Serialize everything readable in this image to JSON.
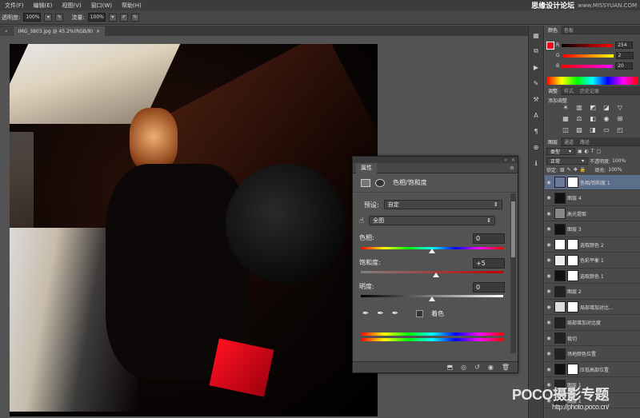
{
  "menubar": {
    "items": [
      "文件(F)",
      "编辑(E)",
      "视图(V)",
      "窗口(W)",
      "帮助(H)"
    ],
    "watermark": "思缘设计论坛",
    "watermark_url": "www.MISSYUAN.COM"
  },
  "optionsbar": {
    "opacity_label": "透明度:",
    "opacity_value": "100%",
    "flow_label": "流量:",
    "flow_value": "100%"
  },
  "tabs": [
    {
      "label": "IMG_3803.jpg @ 45.2%(RGB/8)",
      "close": "×"
    }
  ],
  "properties": {
    "panel_title": "属性",
    "adjustment_name": "色相/饱和度",
    "preset_label": "预设:",
    "preset_value": "自定",
    "channel_value": "全图",
    "hue_label": "色相:",
    "hue_value": "0",
    "saturation_label": "饱和度:",
    "saturation_value": "+5",
    "lightness_label": "明度:",
    "lightness_value": "0",
    "colorize_label": "着色"
  },
  "color_panel": {
    "tabs": [
      "颜色",
      "色板"
    ],
    "r_value": "254",
    "g_value": "2",
    "b_value": "20",
    "foreground_color": "#fe0214"
  },
  "adjust_panel": {
    "tabs": [
      "调整",
      "样式",
      "历史记录"
    ],
    "title": "添加调整"
  },
  "layers_panel": {
    "tabs": [
      "图层",
      "通道",
      "路径"
    ],
    "kind_label": "类型",
    "blend_mode": "正常",
    "opacity_label": "不透明度:",
    "opacity_value": "100%",
    "lock_label": "锁定:",
    "fill_label": "填充:",
    "fill_value": "100%",
    "layers": [
      {
        "name": "色相/饱和度 1",
        "selected": true
      },
      {
        "name": "图层 4",
        "selected": false
      },
      {
        "name": "高光提取",
        "selected": false
      },
      {
        "name": "图层 3",
        "selected": false
      },
      {
        "name": "选取颜色 2",
        "selected": false
      },
      {
        "name": "色彩平衡 1",
        "selected": false
      },
      {
        "name": "选取颜色 1",
        "selected": false
      },
      {
        "name": "图层 2",
        "selected": false
      },
      {
        "name": "局部增加对比...",
        "selected": false
      },
      {
        "name": "局部增加对比度",
        "selected": false
      },
      {
        "name": "裁切",
        "selected": false
      },
      {
        "name": "场地颜色位置",
        "selected": false
      },
      {
        "name": "压低高部位置",
        "selected": false
      },
      {
        "name": "图层 1",
        "selected": false
      },
      {
        "name": "图层 1",
        "selected": false
      }
    ]
  },
  "poco_watermark": {
    "logo": "POCO摄影专题",
    "url": "http://photo.poco.cn/"
  }
}
